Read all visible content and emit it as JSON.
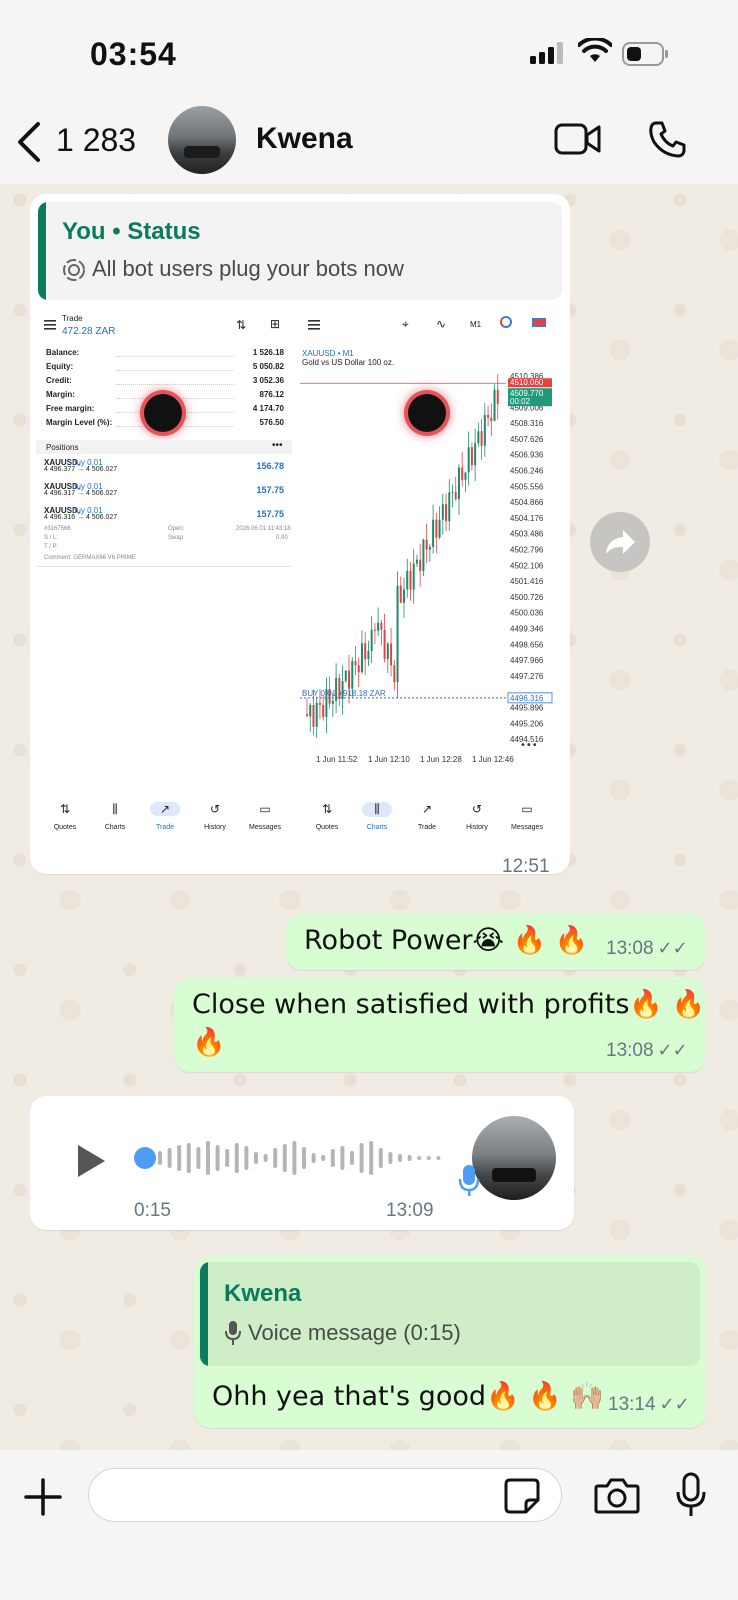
{
  "status_bar": {
    "time": "03:54"
  },
  "header": {
    "back_count": "1 283",
    "contact_name": "Kwena"
  },
  "status_reply": {
    "quote_title": "You • Status",
    "quote_text": "All bot users plug your bots now",
    "time": "12:51",
    "trade": {
      "title": "Trade",
      "balance_header": "472.28 ZAR",
      "rows": [
        {
          "label": "Balance:",
          "value": "1 526.18"
        },
        {
          "label": "Equity:",
          "value": "5 050.82"
        },
        {
          "label": "Credit:",
          "value": "3 052.36"
        },
        {
          "label": "Margin:",
          "value": "876.12"
        },
        {
          "label": "Free margin:",
          "value": "4 174.70"
        },
        {
          "label": "Margin Level (%):",
          "value": "576.50"
        }
      ],
      "positions_label": "Positions",
      "positions": [
        {
          "symbol": "XAUUSD,",
          "type": "buy 0.01",
          "prices": "4 496.377 → 4 506.027",
          "profit": "156.78"
        },
        {
          "symbol": "XAUUSD,",
          "type": "buy 0.01",
          "prices": "4 496.317 → 4 506.027",
          "profit": "157.75"
        },
        {
          "symbol": "XAUUSD,",
          "type": "buy 0.01",
          "prices": "4 496.316 → 4 506.027",
          "profit": "157.75"
        }
      ],
      "detail_id": "#3167566",
      "detail_open": "Open:",
      "detail_date": "2026.06.01 11:43:18",
      "detail_sl": "S / L:",
      "detail_swap": "Swap:",
      "detail_swap_val": "0.00",
      "detail_tp": "T / P:",
      "detail_comment": "Comment:  GERMAX66 V6 PRIME",
      "nav": [
        "Quotes",
        "Charts",
        "Trade",
        "History",
        "Messages"
      ]
    },
    "chart": {
      "symbol": "XAUUSD • M1",
      "subtitle": "Gold vs US Dollar 100 oz.",
      "timeframe": "M1",
      "buy_label": "BUY 0.01  +918.18 ZAR",
      "price_ticks": [
        "4510.386",
        "4509.006",
        "4508.316",
        "4507.626",
        "4506.936",
        "4506.246",
        "4505.556",
        "4504.866",
        "4504.176",
        "4503.486",
        "4502.796",
        "4502.106",
        "4501.416",
        "4500.726",
        "4500.036",
        "4499.346",
        "4498.656",
        "4497.966",
        "4497.276",
        "4495.896",
        "4495.206",
        "4494.516"
      ],
      "current_red": "4510.060",
      "current_green": "4509.770",
      "current_green_sub": "00:02",
      "line_price": "4496.316",
      "time_ticks": [
        "1 Jun 11:52",
        "1 Jun 12:10",
        "1 Jun 12:28",
        "1 Jun 12:46"
      ],
      "nav": [
        "Quotes",
        "Charts",
        "Trade",
        "History",
        "Messages"
      ]
    }
  },
  "messages": [
    {
      "text": "Robot Power😭 🔥 🔥",
      "time": "13:08"
    },
    {
      "text_line1": "Close when satisfied with profits🔥 🔥",
      "text_line2": "🔥",
      "time": "13:08"
    }
  ],
  "voice": {
    "duration": "0:15",
    "time": "13:09"
  },
  "reply": {
    "quote_title": "Kwena",
    "quote_text": "Voice message (0:15)",
    "text": "Ohh yea that's good🔥 🔥 🙌🏼",
    "time": "13:14"
  },
  "input": {
    "placeholder": ""
  }
}
